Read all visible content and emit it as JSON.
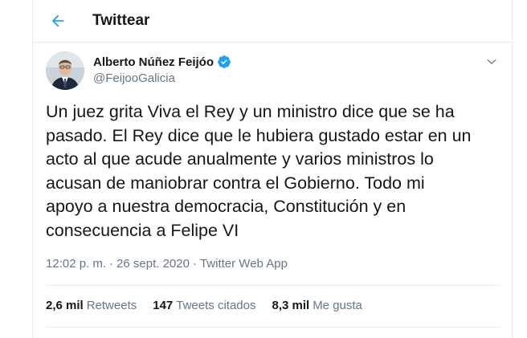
{
  "header": {
    "title": "Twittear",
    "back_icon": "arrow-left-icon",
    "accent_color": "#1da1f2"
  },
  "tweet": {
    "author_name": "Alberto Núñez Feijóo",
    "verified_icon": "verified-badge-icon",
    "handle": "@FeijooGalicia",
    "text": "Un juez grita Viva el Rey y un ministro dice que se ha\npasado. El Rey dice que le hubiera gustado estar en un\nacto al que acude anualmente y varios ministros lo\nacusan de maniobrar contra el Gobierno. Todo mi\napoyo a nuestra democracia, Constitución y en\nconsecuencia a Felipe VI",
    "time": "12:02 p. m.",
    "separator": "·",
    "date": "26 sept. 2020",
    "source": "Twitter Web App"
  },
  "stats": {
    "retweets_count": "2,6 mil",
    "retweets_label": "Retweets",
    "quotes_count": "147",
    "quotes_label": "Tweets citados",
    "likes_count": "8,3 mil",
    "likes_label": "Me gusta"
  }
}
